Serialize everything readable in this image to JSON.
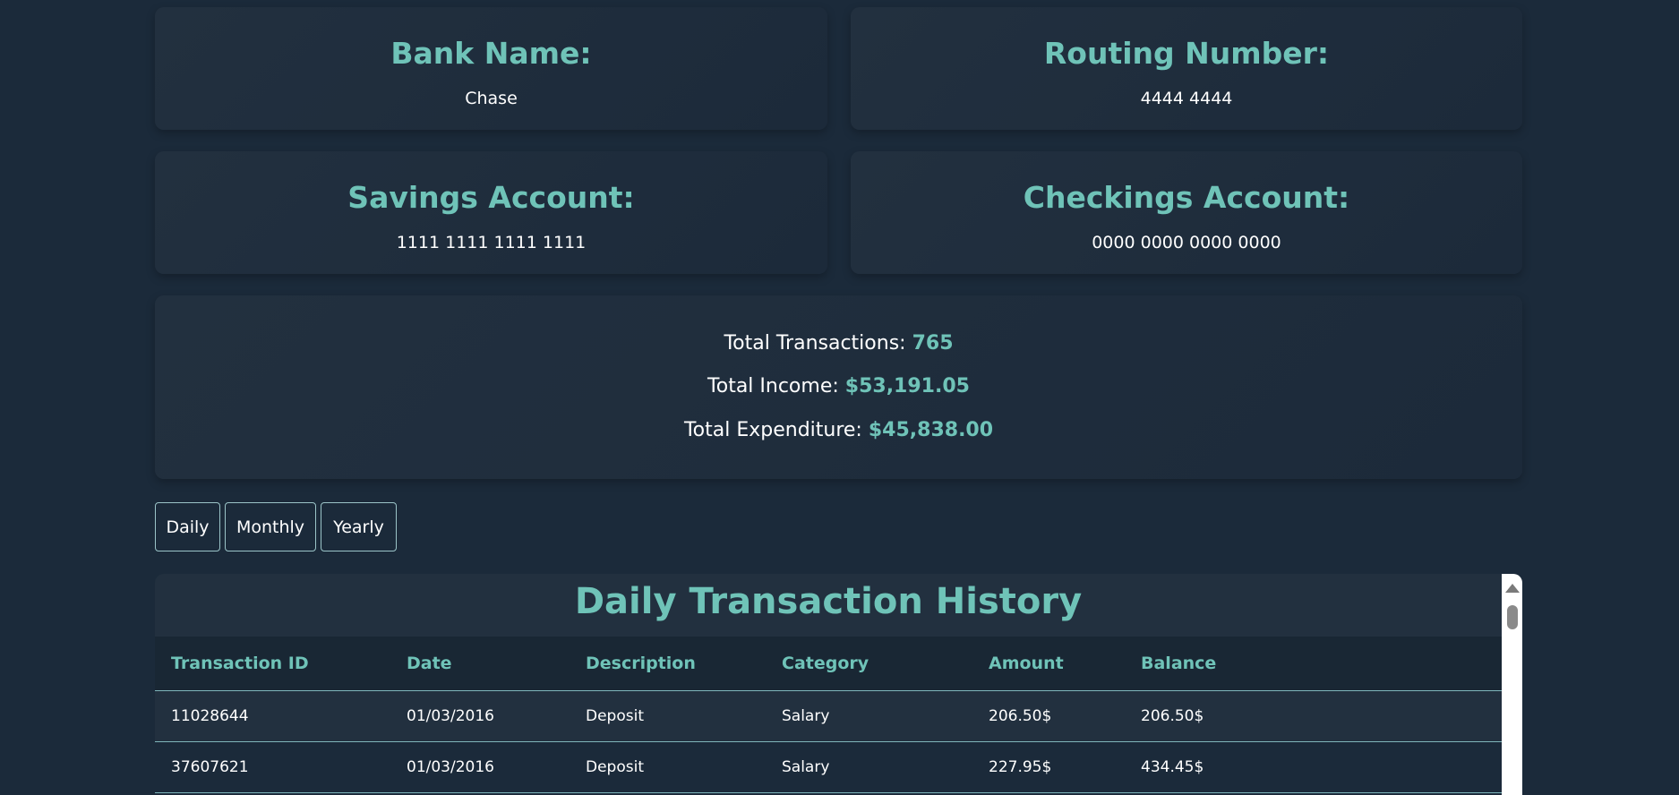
{
  "bank": {
    "label": "Bank Name:",
    "value": "Chase"
  },
  "routing": {
    "label": "Routing Number:",
    "value": "4444 4444"
  },
  "savings": {
    "label": "Savings Account:",
    "value": "1111 1111 1111 1111"
  },
  "checking": {
    "label": "Checkings Account:",
    "value": "0000 0000 0000 0000"
  },
  "summary": {
    "transactions_label": "Total Transactions:",
    "transactions_value": "765",
    "income_label": "Total Income:",
    "income_value": "$53,191.05",
    "expenditure_label": "Total Expenditure:",
    "expenditure_value": "$45,838.00"
  },
  "tabs": {
    "daily": "Daily",
    "monthly": "Monthly",
    "yearly": "Yearly"
  },
  "history": {
    "title": "Daily Transaction History",
    "columns": [
      "Transaction ID",
      "Date",
      "Description",
      "Category",
      "Amount",
      "Balance"
    ],
    "rows": [
      [
        "11028644",
        "01/03/2016",
        "Deposit",
        "Salary",
        "206.50$",
        "206.50$"
      ],
      [
        "37607621",
        "01/03/2016",
        "Deposit",
        "Salary",
        "227.95$",
        "434.45$"
      ]
    ]
  },
  "colors": {
    "background": "#1b2a3a",
    "accent": "#6fc3b8",
    "card": "#22303f",
    "border": "#7fb6bb"
  },
  "icons": {
    "scroll_up": "triangle-up-icon"
  }
}
